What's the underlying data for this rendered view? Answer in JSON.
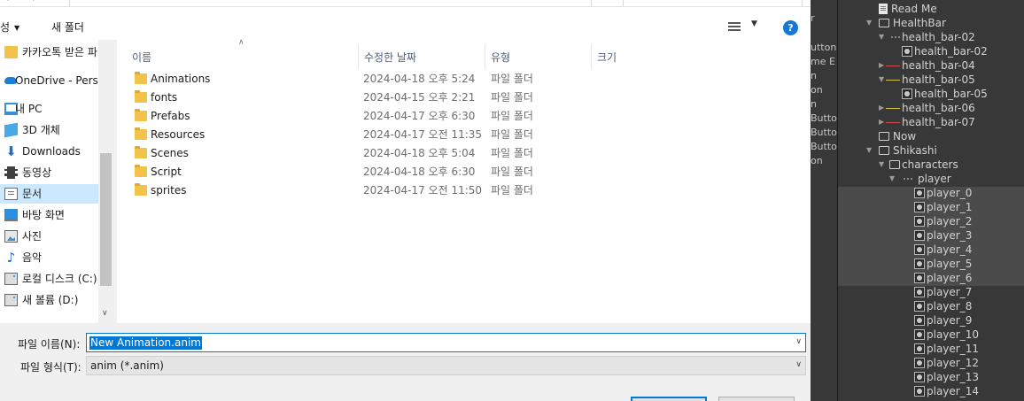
{
  "dialog": {
    "toolbar": {
      "organize_label": "성",
      "new_folder_label": "새 폴더",
      "help_label": "?"
    },
    "nav_items": [
      {
        "label": "카카오톡 받은 파",
        "icon": "folder-icon"
      },
      {
        "label": "OneDrive - Perso",
        "icon": "onedrive-icon"
      },
      {
        "label": "내 PC",
        "icon": "pc-icon"
      },
      {
        "label": "3D 개체",
        "icon": "3d-objects-icon"
      },
      {
        "label": "Downloads",
        "icon": "download-icon"
      },
      {
        "label": "동영상",
        "icon": "video-icon"
      },
      {
        "label": "문서",
        "icon": "documents-icon"
      },
      {
        "label": "바탕 화면",
        "icon": "desktop-icon"
      },
      {
        "label": "사진",
        "icon": "pictures-icon"
      },
      {
        "label": "음악",
        "icon": "music-icon"
      },
      {
        "label": "로컬 디스크 (C:)",
        "icon": "drive-icon"
      },
      {
        "label": "새 볼륨 (D:)",
        "icon": "drive-icon"
      }
    ],
    "columns": {
      "name": "이름",
      "modified": "수정한 날짜",
      "type": "유형",
      "size": "크기"
    },
    "files": [
      {
        "name": "Animations",
        "date": "2024-04-18 오후 5:24",
        "type": "파일 폴더"
      },
      {
        "name": "fonts",
        "date": "2024-04-15 오후 2:21",
        "type": "파일 폴더"
      },
      {
        "name": "Prefabs",
        "date": "2024-04-17 오후 6:30",
        "type": "파일 폴더"
      },
      {
        "name": "Resources",
        "date": "2024-04-17 오전 11:35",
        "type": "파일 폴더"
      },
      {
        "name": "Scenes",
        "date": "2024-04-18 오후 5:04",
        "type": "파일 폴더"
      },
      {
        "name": "Script",
        "date": "2024-04-18 오후 6:30",
        "type": "파일 폴더"
      },
      {
        "name": "sprites",
        "date": "2024-04-17 오전 11:50",
        "type": "파일 폴더"
      }
    ],
    "filename_label": "파일 이름(N):",
    "filename_value": "New Animation.anim",
    "filetype_label": "파일 형식(T):",
    "filetype_value": "anim (*.anim)"
  },
  "unity": {
    "ghost_texts": [
      "r",
      "utton",
      "me E",
      "n",
      "on",
      "n",
      "Butto",
      "Butto",
      "Butto",
      "on"
    ],
    "tree": [
      {
        "label": "Read Me",
        "icon": "file-icon",
        "arrow": ""
      },
      {
        "label": "HealthBar",
        "icon": "folder-open-icon",
        "arrow": "▼"
      },
      {
        "label": "health_bar-02",
        "icon": "dots-icon",
        "arrow": "▼"
      },
      {
        "label": "health_bar-02",
        "icon": "sprite-icon",
        "arrow": ""
      },
      {
        "label": "health_bar-04",
        "icon": "red-line-icon",
        "arrow": "▶"
      },
      {
        "label": "health_bar-05",
        "icon": "yellow-line-icon",
        "arrow": "▼"
      },
      {
        "label": "health_bar-05",
        "icon": "sprite-icon",
        "arrow": ""
      },
      {
        "label": "health_bar-06",
        "icon": "yellow-line-icon",
        "arrow": "▶"
      },
      {
        "label": "health_bar-07",
        "icon": "red-line-icon",
        "arrow": "▶"
      },
      {
        "label": "Now",
        "icon": "folder-icon",
        "arrow": ""
      },
      {
        "label": "Shikashi",
        "icon": "folder-open-icon",
        "arrow": "▼"
      },
      {
        "label": "characters",
        "icon": "folder-open-icon",
        "arrow": "▼"
      },
      {
        "label": "player",
        "icon": "dots-icon",
        "arrow": "▼"
      },
      {
        "label": "player_0",
        "icon": "sprite-icon",
        "arrow": ""
      },
      {
        "label": "player_1",
        "icon": "sprite-icon",
        "arrow": ""
      },
      {
        "label": "player_2",
        "icon": "sprite-icon",
        "arrow": ""
      },
      {
        "label": "player_3",
        "icon": "sprite-icon",
        "arrow": ""
      },
      {
        "label": "player_4",
        "icon": "sprite-icon",
        "arrow": ""
      },
      {
        "label": "player_5",
        "icon": "sprite-icon",
        "arrow": ""
      },
      {
        "label": "player_6",
        "icon": "sprite-icon",
        "arrow": ""
      },
      {
        "label": "player_7",
        "icon": "sprite-icon",
        "arrow": ""
      },
      {
        "label": "player_8",
        "icon": "sprite-icon",
        "arrow": ""
      },
      {
        "label": "player_9",
        "icon": "sprite-icon",
        "arrow": ""
      },
      {
        "label": "player_10",
        "icon": "sprite-icon",
        "arrow": ""
      },
      {
        "label": "player_11",
        "icon": "sprite-icon",
        "arrow": ""
      },
      {
        "label": "player_12",
        "icon": "sprite-icon",
        "arrow": ""
      },
      {
        "label": "player_13",
        "icon": "sprite-icon",
        "arrow": ""
      },
      {
        "label": "player_14",
        "icon": "sprite-icon",
        "arrow": ""
      }
    ]
  }
}
